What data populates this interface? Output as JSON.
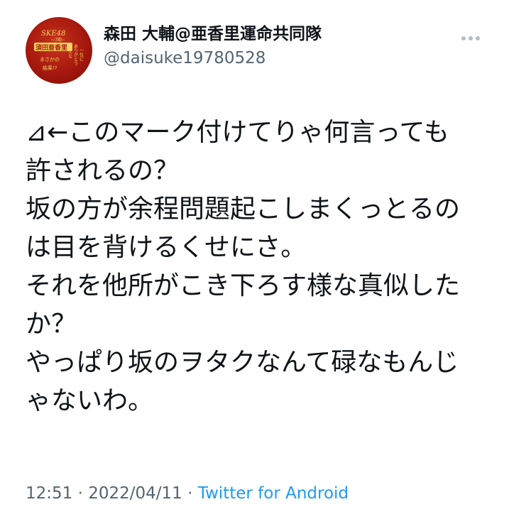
{
  "user": {
    "display_name": "森田 大輔@亜香里運命共同隊",
    "handle": "@daisuke19780528",
    "avatar_text": "SKE48 ~3期生~ 須田亜香里 まさかの結果 なんで一位に? みんなの応援 ありがとう"
  },
  "tweet": {
    "lines": [
      "⊿←このマーク付けてりゃ何言っても",
      "許されるの？",
      "坂の方が余程問題起こしまくっとるの",
      "は目を背けるくせにさ。",
      "それを他所がこき下ろす様な真似した",
      "か？",
      "やっぱり坂のヲタクなんて碌なもんじ",
      "ゃないわ。"
    ]
  },
  "meta": {
    "time": "12:51",
    "separator1": " · ",
    "date": "2022/04/11",
    "separator2": " · ",
    "source": "Twitter for Android"
  },
  "colors": {
    "text": "#0f1419",
    "muted": "#536471",
    "accent": "#1d9bf0",
    "avatar": "#b01d10"
  },
  "icons": {
    "more": "more-horizontal-icon"
  }
}
